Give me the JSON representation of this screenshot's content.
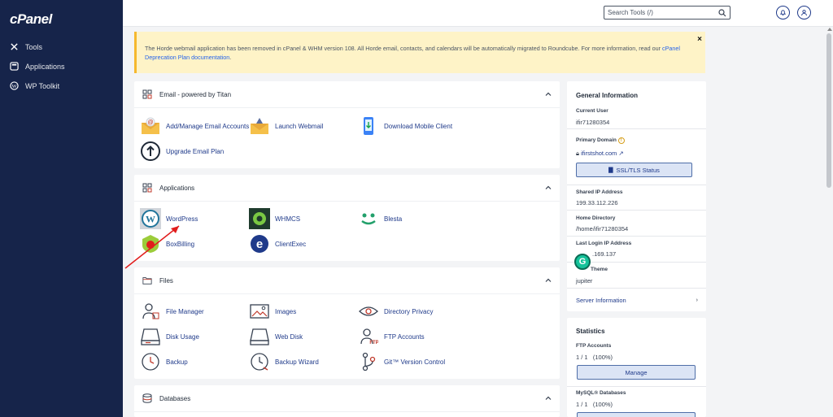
{
  "app": {
    "logo": "cPanel"
  },
  "sidebar": {
    "items": [
      {
        "label": "Tools",
        "icon": "tools-icon"
      },
      {
        "label": "Applications",
        "icon": "applications-icon"
      },
      {
        "label": "WP Toolkit",
        "icon": "wordpress-icon"
      }
    ]
  },
  "topbar": {
    "search_placeholder": "Search Tools (/)"
  },
  "notice": {
    "text": "The Horde webmail application has been removed in cPanel & WHM version 108. All Horde email, contacts, and calendars will be automatically migrated to Roundcube. For more information, read our ",
    "link": "cPanel Deprecation Plan documentation",
    "suffix": ".",
    "close": "×"
  },
  "email_panel": {
    "title": "Email - powered by Titan",
    "items": [
      "Add/Manage Email Accounts",
      "Launch Webmail",
      "Download Mobile Client",
      "Upgrade Email Plan"
    ]
  },
  "applications_panel": {
    "title": "Applications",
    "items": [
      "WordPress",
      "WHMCS",
      "Blesta",
      "BoxBilling",
      "ClientExec"
    ]
  },
  "files_panel": {
    "title": "Files",
    "items": [
      "File Manager",
      "Images",
      "Directory Privacy",
      "Disk Usage",
      "Web Disk",
      "FTP Accounts",
      "Backup",
      "Backup Wizard",
      "Git™ Version Control"
    ]
  },
  "databases_panel": {
    "title": "Databases"
  },
  "general_info": {
    "title": "General Information",
    "current_user_label": "Current User",
    "current_user": "ifir71280354",
    "primary_domain_label": "Primary Domain",
    "primary_domain": "ifirstshot.com",
    "ssl_button": "SSL/TLS Status",
    "shared_ip_label": "Shared IP Address",
    "shared_ip": "199.33.112.226",
    "home_dir_label": "Home Directory",
    "home_dir": "/home/ifir71280354",
    "last_login_label": "Last Login IP Address",
    "last_login": ".169.137",
    "theme_label": "Theme",
    "theme": "jupiter",
    "server_info": "Server Information"
  },
  "statistics": {
    "title": "Statistics",
    "ftp_label": "FTP Accounts",
    "ftp_value": "1 / 1",
    "ftp_pct": "(100%)",
    "manage_button": "Manage",
    "mysql_label": "MySQL® Databases",
    "mysql_value": "1 / 1",
    "mysql_pct": "(100%)"
  },
  "colors": {
    "sidebar_bg": "#16244a",
    "accent_blue": "#1f3a8a",
    "notice_bg": "#fef3c7",
    "annotation_arrow": "#e11d1d"
  }
}
